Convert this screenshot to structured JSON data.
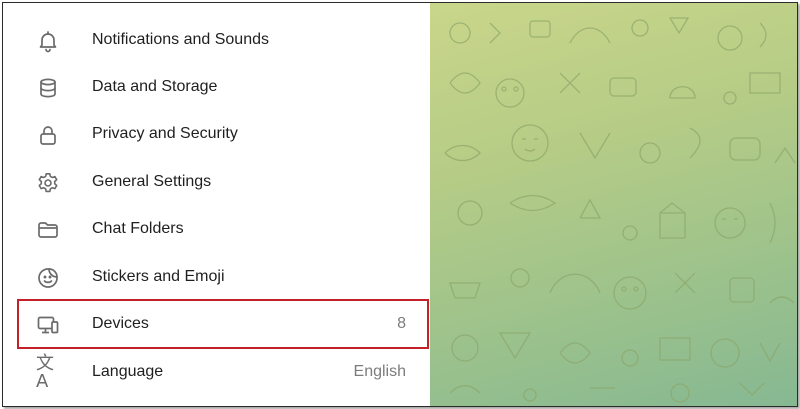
{
  "settings": {
    "items": [
      {
        "label": "Notifications and Sounds",
        "icon": "bell-icon",
        "value": ""
      },
      {
        "label": "Data and Storage",
        "icon": "database-icon",
        "value": ""
      },
      {
        "label": "Privacy and Security",
        "icon": "lock-icon",
        "value": ""
      },
      {
        "label": "General Settings",
        "icon": "gear-icon",
        "value": ""
      },
      {
        "label": "Chat Folders",
        "icon": "folder-icon",
        "value": ""
      },
      {
        "label": "Stickers and Emoji",
        "icon": "sticker-icon",
        "value": ""
      },
      {
        "label": "Devices",
        "icon": "devices-icon",
        "value": "8"
      },
      {
        "label": "Language",
        "icon": "translate-icon",
        "value": "English"
      }
    ],
    "language_icon_glyph": "文A"
  },
  "colors": {
    "highlight": "#c3202a",
    "icon": "#6b6b6b",
    "text": "#1f1f1f",
    "secondary_text": "#7c7c7c",
    "wallpaper_top": "#c9d68a",
    "wallpaper_bottom": "#86b892"
  }
}
